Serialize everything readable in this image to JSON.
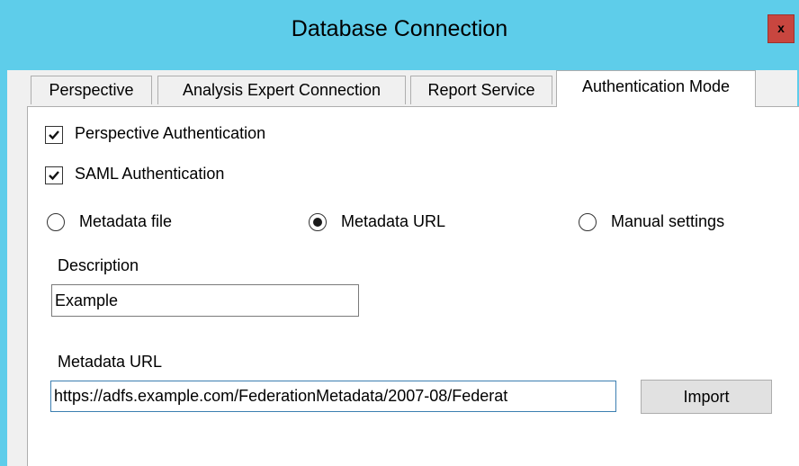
{
  "window": {
    "title": "Database Connection",
    "close_label": "x"
  },
  "tabs": [
    {
      "label": "Perspective",
      "active": false
    },
    {
      "label": "Analysis Expert Connection",
      "active": false
    },
    {
      "label": "Report Service",
      "active": false
    },
    {
      "label": "Authentication Mode",
      "active": true
    }
  ],
  "auth": {
    "perspective_auth": {
      "label": "Perspective Authentication",
      "checked": true
    },
    "saml_auth": {
      "label": "SAML Authentication",
      "checked": true
    }
  },
  "source_options": [
    {
      "label": "Metadata file",
      "selected": false
    },
    {
      "label": "Metadata URL",
      "selected": true
    },
    {
      "label": "Manual settings",
      "selected": false
    }
  ],
  "description": {
    "label": "Description",
    "value": "Example"
  },
  "metadata_url": {
    "label": "Metadata URL",
    "value": "https://adfs.example.com/FederationMetadata/2007-08/Federat"
  },
  "import_button": {
    "label": "Import"
  },
  "colors": {
    "titlebar": "#5ecdea",
    "close": "#c8463f",
    "panel": "#ffffff"
  }
}
